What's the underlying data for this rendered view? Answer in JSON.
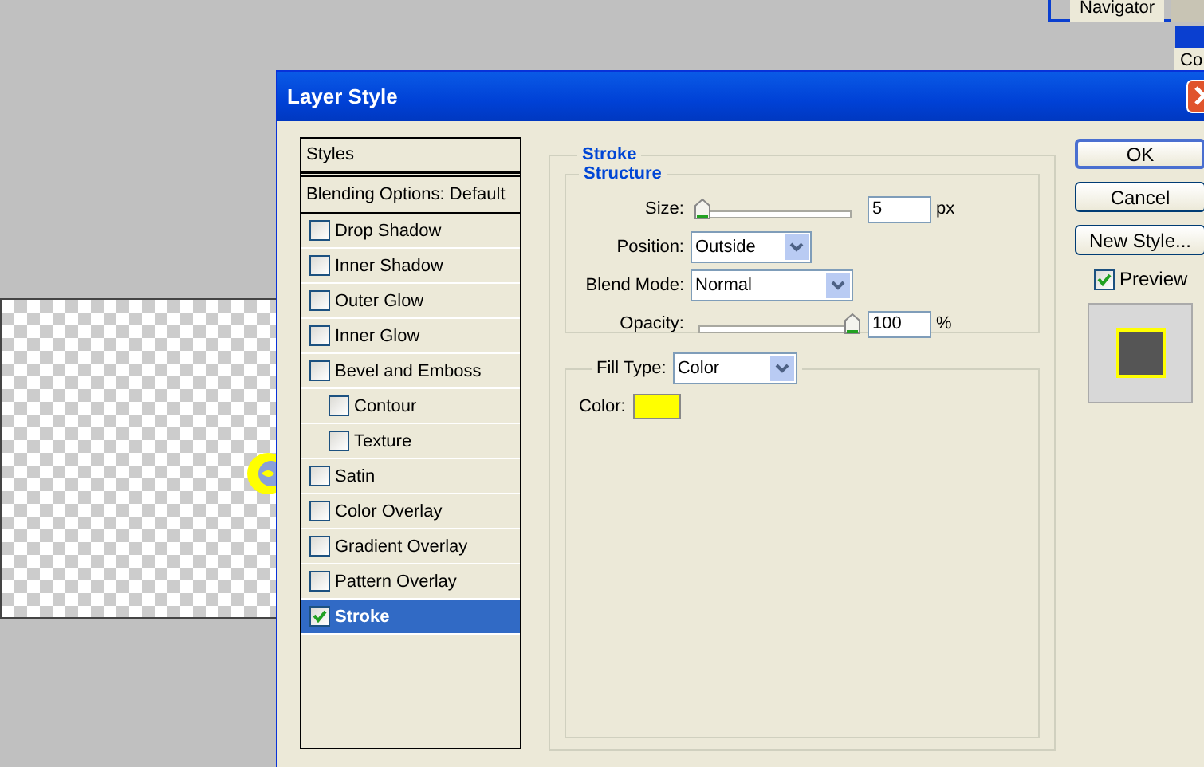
{
  "background_panels": {
    "navigator_tab": "Navigator",
    "second_panel_tab": "Co"
  },
  "window": {
    "title": "Layer Style"
  },
  "styles_list": {
    "header": "Styles",
    "blending_options": "Blending Options: Default",
    "items": [
      {
        "label": "Drop Shadow",
        "checked": false,
        "selected": false
      },
      {
        "label": "Inner Shadow",
        "checked": false,
        "selected": false
      },
      {
        "label": "Outer Glow",
        "checked": false,
        "selected": false
      },
      {
        "label": "Inner Glow",
        "checked": false,
        "selected": false
      },
      {
        "label": "Bevel and Emboss",
        "checked": false,
        "selected": false,
        "children": [
          {
            "label": "Contour",
            "checked": false,
            "selected": false
          },
          {
            "label": "Texture",
            "checked": false,
            "selected": false
          }
        ]
      },
      {
        "label": "Satin",
        "checked": false,
        "selected": false
      },
      {
        "label": "Color Overlay",
        "checked": false,
        "selected": false
      },
      {
        "label": "Gradient Overlay",
        "checked": false,
        "selected": false
      },
      {
        "label": "Pattern Overlay",
        "checked": false,
        "selected": false
      },
      {
        "label": "Stroke",
        "checked": true,
        "selected": true
      }
    ]
  },
  "stroke": {
    "title": "Stroke",
    "structure": {
      "title": "Structure",
      "size": {
        "label": "Size:",
        "level": 0.02,
        "value": "5",
        "unit": "px"
      },
      "position": {
        "label": "Position:",
        "value": "Outside"
      },
      "blend_mode": {
        "label": "Blend Mode:",
        "value": "Normal"
      },
      "opacity": {
        "label": "Opacity:",
        "level": 1.0,
        "value": "100",
        "unit": "%"
      }
    },
    "fill": {
      "label": "Fill Type:",
      "value": "Color",
      "color_label": "Color:",
      "color": "#ffff00"
    }
  },
  "buttons": [
    "OK",
    "Cancel",
    "New Style..."
  ],
  "preview": {
    "label": "Preview",
    "checked": true
  }
}
